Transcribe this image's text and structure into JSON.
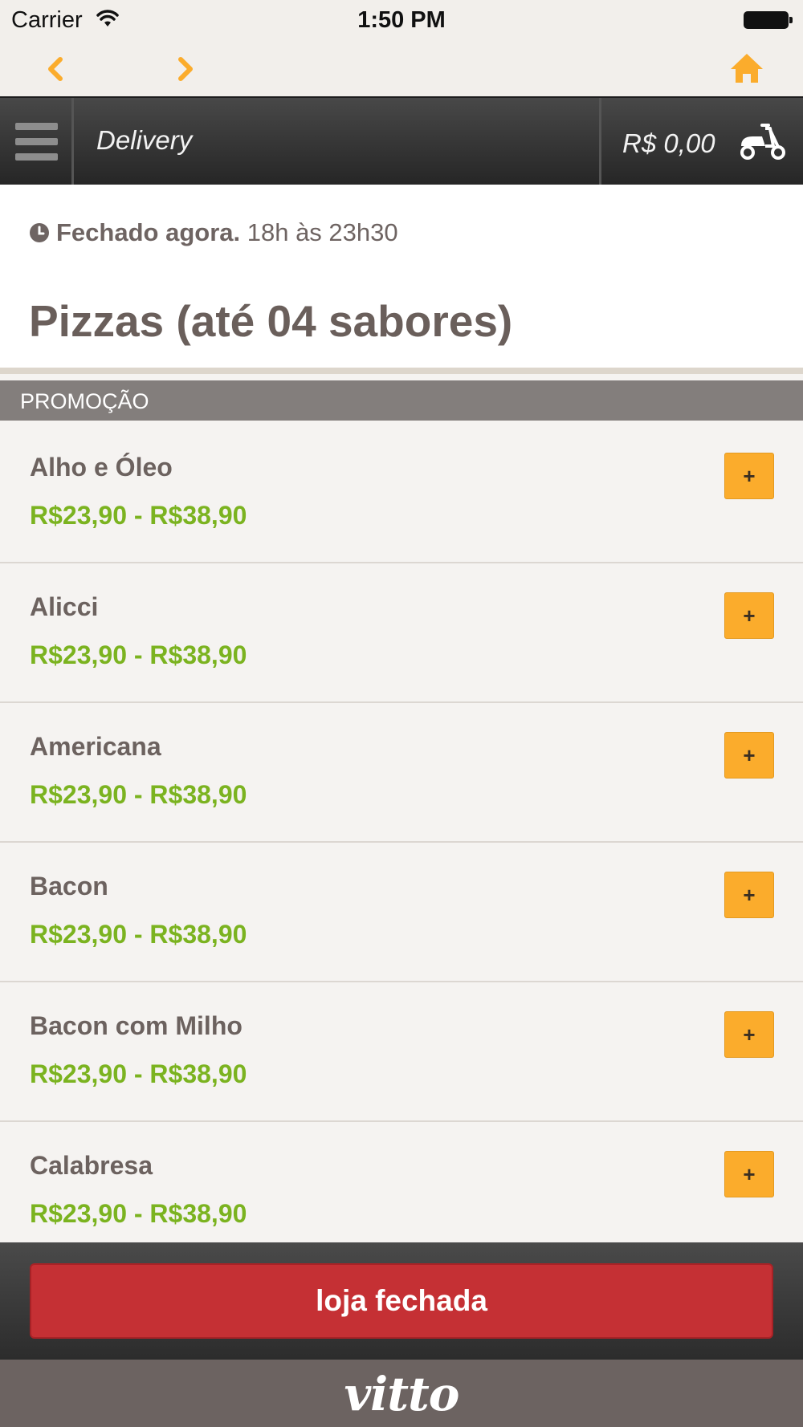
{
  "status_bar": {
    "carrier": "Carrier",
    "time": "1:50 PM"
  },
  "nav": {
    "back_icon": "chevron-left-icon",
    "forward_icon": "chevron-right-icon",
    "home_icon": "home-icon",
    "accent": "#fbac2c"
  },
  "header": {
    "title": "Delivery",
    "cart_total": "R$ 0,00",
    "cart_icon": "scooter-icon"
  },
  "store": {
    "closed_label": "Fechado agora.",
    "hours": "18h às 23h30"
  },
  "category": {
    "title": "Pizzas (até 04 sabores)",
    "section": "PROMOÇÃO"
  },
  "products": [
    {
      "name": "Alho e Óleo",
      "price": "R$23,90 - R$38,90",
      "add_label": "+"
    },
    {
      "name": "Alicci",
      "price": "R$23,90 - R$38,90",
      "add_label": "+"
    },
    {
      "name": "Americana",
      "price": "R$23,90 - R$38,90",
      "add_label": "+"
    },
    {
      "name": "Bacon",
      "price": "R$23,90 - R$38,90",
      "add_label": "+"
    },
    {
      "name": "Bacon com Milho",
      "price": "R$23,90 - R$38,90",
      "add_label": "+"
    },
    {
      "name": "Calabresa",
      "price": "R$23,90 - R$38,90",
      "add_label": "+"
    }
  ],
  "footer": {
    "button_label": "loja fechada",
    "button_color": "#c53034"
  },
  "brand": {
    "logo_text": "vitto"
  },
  "colors": {
    "price": "#7bb320",
    "add_button": "#fbac2c",
    "section_header": "#837e7c"
  }
}
